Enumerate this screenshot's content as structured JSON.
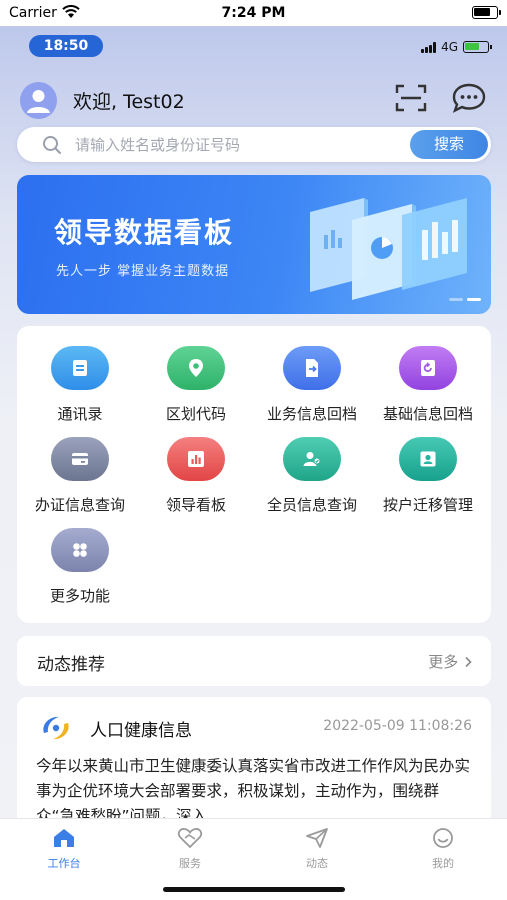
{
  "ios_status": {
    "carrier": "Carrier",
    "time": "7:24 PM"
  },
  "device_status": {
    "time": "18:50",
    "network": "4G"
  },
  "header": {
    "welcome": "欢迎, Test02"
  },
  "search": {
    "placeholder": "请输入姓名或身份证号码",
    "button_label": "搜索"
  },
  "banner": {
    "title": "领导数据看板",
    "subtitle": "先人一步 掌握业务主题数据"
  },
  "features": [
    {
      "label": "通讯录",
      "icon": "contacts-book-icon",
      "color": "#3aa0ee"
    },
    {
      "label": "区划代码",
      "icon": "location-pin-icon",
      "color": "#3cc07a"
    },
    {
      "label": "业务信息回档",
      "icon": "document-export-icon",
      "color": "#4c7df0"
    },
    {
      "label": "基础信息回档",
      "icon": "refresh-document-icon",
      "color": "#a35ce6"
    },
    {
      "label": "办证信息查询",
      "icon": "card-icon",
      "color": "#7f88a3"
    },
    {
      "label": "领导看板",
      "icon": "bar-chart-icon",
      "color": "#ef5b5b"
    },
    {
      "label": "全员信息查询",
      "icon": "user-group-icon",
      "color": "#2fb59b"
    },
    {
      "label": "按户迁移管理",
      "icon": "id-card-icon",
      "color": "#27b4a0"
    },
    {
      "label": "更多功能",
      "icon": "more-grid-icon",
      "color": "#8890b8"
    }
  ],
  "news": {
    "section_title": "动态推荐",
    "more_label": "更多",
    "item": {
      "title": "人口健康信息",
      "time": "2022-05-09 11:08:26",
      "body": "今年以来黄山市卫生健康委认真落实省市改进工作作风为民办实事为企优环境大会部署要求，积极谋划，主动作为，围绕群众“急难愁盼”问题，深入..."
    }
  },
  "tabbar": [
    {
      "label": "工作台",
      "icon": "home-icon",
      "active": true
    },
    {
      "label": "服务",
      "icon": "service-icon",
      "active": false
    },
    {
      "label": "动态",
      "icon": "send-icon",
      "active": false
    },
    {
      "label": "我的",
      "icon": "profile-icon",
      "active": false
    }
  ],
  "colors": {
    "accent": "#3a7ee6",
    "banner_start": "#2d6ff0",
    "banner_end": "#6fb3fb"
  }
}
